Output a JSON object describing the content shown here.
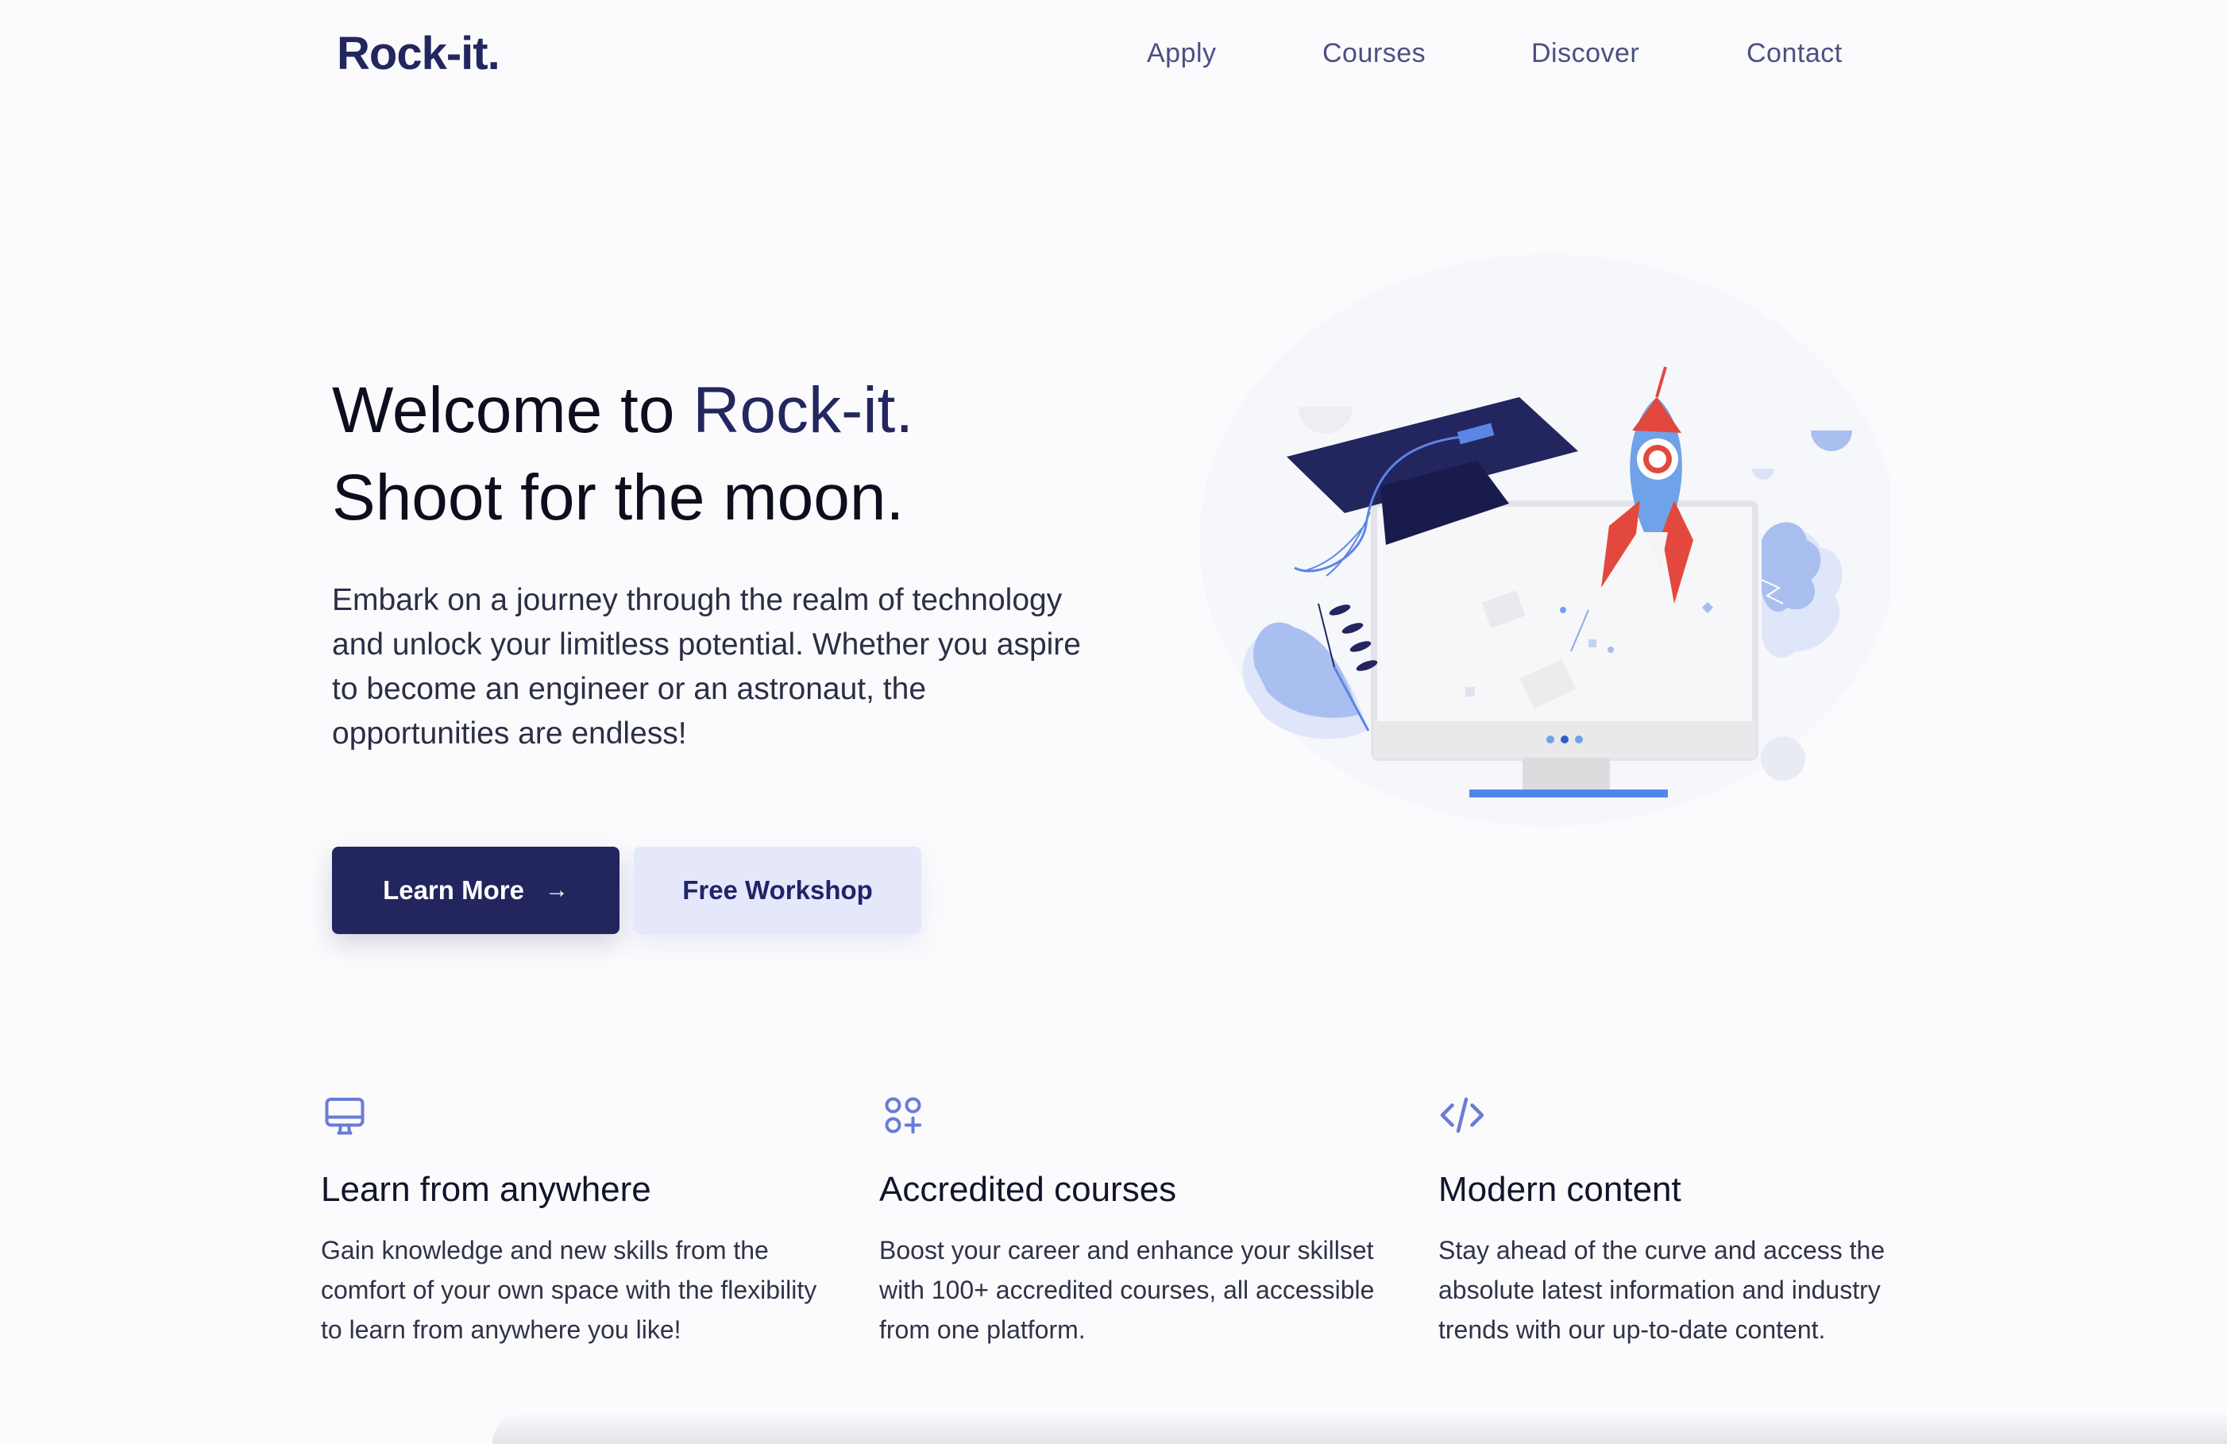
{
  "header": {
    "logo": "Rock-it.",
    "nav": [
      "Apply",
      "Courses",
      "Discover",
      "Contact"
    ]
  },
  "hero": {
    "title_line1_prefix": "Welcome to ",
    "title_line1_brand": "Rock-it.",
    "title_line2": "Shoot for the moon.",
    "description": "Embark on a journey through the realm of technology and unlock your limitless potential. Whether you aspire to become an engineer or an astronaut, the opportunities are endless!",
    "primary_button": "Learn More",
    "secondary_button": "Free Workshop"
  },
  "illustration": {
    "icons": [
      "graduation-cap",
      "rocket",
      "computer-monitor"
    ]
  },
  "features": [
    {
      "icon": "monitor-icon",
      "title": "Learn from anywhere",
      "text": "Gain knowledge and new skills from the comfort of your own space with the flexibility to learn from anywhere you like!"
    },
    {
      "icon": "apps-add-icon",
      "title": "Accredited courses",
      "text": "Boost your career and enhance your skillset with 100+ accredited courses, all accessible from one platform."
    },
    {
      "icon": "code-icon",
      "title": "Modern content",
      "text": "Stay ahead of the curve and access the absolute latest information and industry trends with our up-to-date content."
    }
  ],
  "colors": {
    "brand": "#23275f",
    "accent": "#6b7cd6",
    "rocket_red": "#e2483e",
    "rocket_blue": "#6fa2e8",
    "background": "#fbfbfd"
  }
}
